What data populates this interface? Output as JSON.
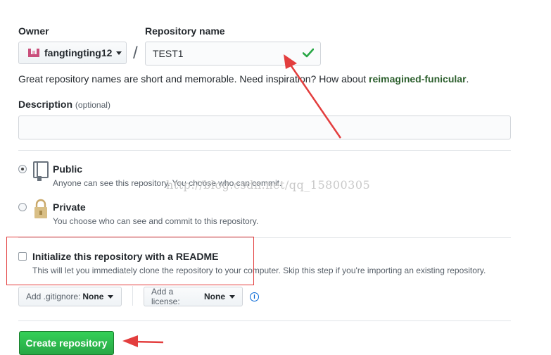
{
  "owner": {
    "label": "Owner",
    "name": "fangtingting12"
  },
  "repo": {
    "label": "Repository name",
    "value": "TEST1",
    "separator": "/"
  },
  "hint": {
    "prefix": "Great repository names are short and memorable. Need inspiration? How about ",
    "suggestion": "reimagined-funicular",
    "suffix": "."
  },
  "description": {
    "label": "Description",
    "optional": "(optional)",
    "value": ""
  },
  "visibility": {
    "public": {
      "title": "Public",
      "note": "Anyone can see this repository. You choose who can commit."
    },
    "private": {
      "title": "Private",
      "note": "You choose who can see and commit to this repository."
    }
  },
  "init": {
    "title": "Initialize this repository with a README",
    "note": "This will let you immediately clone the repository to your computer. Skip this step if you're importing an existing repository."
  },
  "gitignore": {
    "label": "Add .gitignore:",
    "value": "None"
  },
  "license": {
    "label": "Add a license:",
    "value": "None"
  },
  "info_icon_text": "i",
  "create_button": "Create repository",
  "watermark": "http://blog.csdn.net/qq_15800305",
  "colors": {
    "accent_green": "#28a745",
    "annotation_red": "#e33e3e",
    "link_blue": "#0366d6"
  }
}
